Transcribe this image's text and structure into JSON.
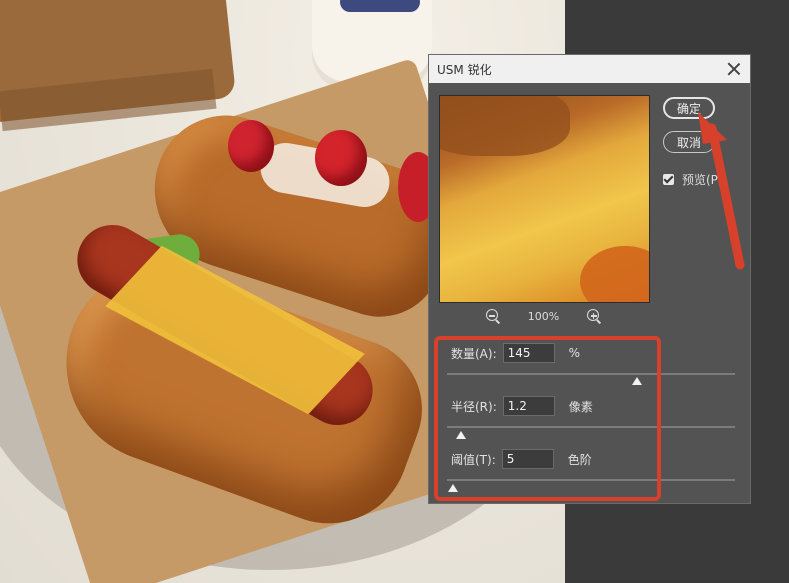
{
  "dialog": {
    "title": "USM 锐化",
    "zoom": "100%",
    "ok_label": "确定",
    "cancel_label": "取消",
    "preview_label": "预览(P)",
    "preview_checked": true
  },
  "params": [
    {
      "label": "数量(A):",
      "value": "145",
      "unit": "%",
      "slider_fraction": 0.66
    },
    {
      "label": "半径(R):",
      "value": "1.2",
      "unit": "像素",
      "slider_fraction": 0.05
    },
    {
      "label": "阈值(T):",
      "value": "5",
      "unit": "色阶",
      "slider_fraction": 0.02
    }
  ],
  "annotations": {
    "highlight_color": "#d7402a"
  }
}
